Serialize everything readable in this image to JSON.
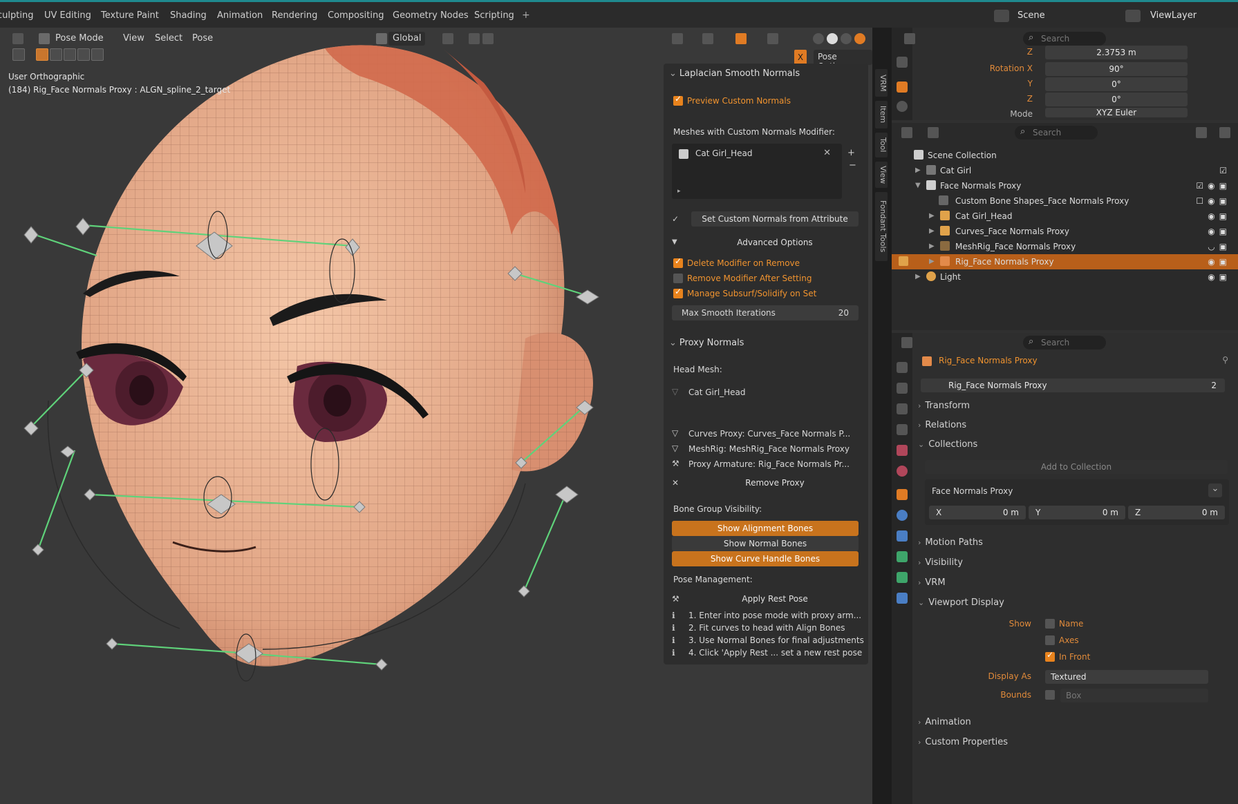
{
  "workspace_tabs": [
    "culpting",
    "UV Editing",
    "Texture Paint",
    "Shading",
    "Animation",
    "Rendering",
    "Compositing",
    "Geometry Nodes",
    "Scripting"
  ],
  "scene": {
    "label": "Scene"
  },
  "view_layer": {
    "label": "ViewLayer"
  },
  "viewport": {
    "mode": "Pose Mode",
    "menus": [
      "View",
      "Select",
      "Pose"
    ],
    "transform_orientation": "Global",
    "info_line1": "User Orthographic",
    "info_line2": "(184) Rig_Face Normals Proxy : ALGN_spline_2_target",
    "pose_options": "Pose Options",
    "x_label": "X"
  },
  "side_tabs": [
    "VRM",
    "Item",
    "Tool",
    "View",
    "Fondant Tools"
  ],
  "laplacian": {
    "title": "Laplacian Smooth Normals",
    "preview_label": "Preview Custom Normals",
    "preview_checked": true,
    "meshes_label": "Meshes with Custom Normals Modifier:",
    "list_item": "Cat Girl_Head",
    "set_button": "Set Custom Normals from Attribute",
    "advanced_label": "Advanced Options",
    "delete_mod": "Delete Modifier on Remove",
    "remove_after": "Remove Modifier After Setting",
    "manage_subsurf": "Manage Subsurf/Solidify on Set",
    "max_iter_label": "Max Smooth Iterations",
    "max_iter_value": "20"
  },
  "proxy": {
    "title": "Proxy Normals",
    "head_mesh_label": "Head Mesh:",
    "head_mesh_value": "Cat Girl_Head",
    "curves_proxy": "Curves Proxy: Curves_Face Normals P...",
    "meshrig": "MeshRig: MeshRig_Face Normals Proxy",
    "proxy_armature": "Proxy Armature: Rig_Face Normals Pr...",
    "remove_proxy": "Remove Proxy",
    "bone_group_label": "Bone Group Visibility:",
    "show_alignment": "Show Alignment Bones",
    "show_normal": "Show Normal Bones",
    "show_curve": "Show Curve Handle Bones",
    "pose_mgmt_label": "Pose Management:",
    "apply_rest": "Apply Rest Pose",
    "steps": [
      "1. Enter into pose mode with proxy arm...",
      "2. Fit curves to head with Align Bones",
      "3. Use Normal Bones for final adjustments",
      "4. Click 'Apply Rest ... set a new rest pose"
    ]
  },
  "top_props": {
    "search_placeholder": "Search",
    "z_label": "Z",
    "z_value": "2.3753 m",
    "rot_label": "Rotation X",
    "rot_x": "90°",
    "y_label": "Y",
    "rot_y": "0°",
    "z2_label": "Z",
    "rot_z": "0°",
    "mode_label": "Mode",
    "mode_value": "XYZ Euler"
  },
  "outliner": {
    "search_placeholder": "Search",
    "root": "Scene Collection",
    "rows": [
      {
        "name": "Cat Girl",
        "dim": true
      },
      {
        "name": "Face Normals Proxy",
        "dim": false
      },
      {
        "name": "Custom Bone Shapes_Face Normals Proxy",
        "dim": true
      },
      {
        "name": "Cat Girl_Head",
        "dim": false
      },
      {
        "name": "Curves_Face Normals Proxy",
        "dim": false
      },
      {
        "name": "MeshRig_Face Normals Proxy",
        "dim": true
      },
      {
        "name": "Rig_Face Normals Proxy",
        "dim": false
      },
      {
        "name": "Light",
        "dim": false
      }
    ]
  },
  "properties": {
    "search_placeholder": "Search",
    "object_name_header": "Rig_Face Normals Proxy",
    "object_name_field": "Rig_Face Normals Proxy",
    "users": "2",
    "sections": [
      "Transform",
      "Relations",
      "Collections",
      "Motion Paths",
      "Visibility",
      "VRM",
      "Viewport Display",
      "Animation",
      "Custom Properties"
    ],
    "add_to_collection": "Add to Collection",
    "collection_name": "Face Normals Proxy",
    "offset_x_label": "X",
    "offset_x": "0 m",
    "offset_y_label": "Y",
    "offset_y": "0 m",
    "offset_z_label": "Z",
    "offset_z": "0 m",
    "show_label": "Show",
    "show_name": "Name",
    "show_axes": "Axes",
    "show_infront": "In Front",
    "display_as_label": "Display As",
    "display_as": "Textured",
    "bounds_label": "Bounds",
    "bounds_value": "Box"
  },
  "colors": {
    "accent": "#e8831d",
    "selection": "#b85f1a",
    "bone_line": "#5fd27a",
    "skin": "#e7b08e"
  }
}
